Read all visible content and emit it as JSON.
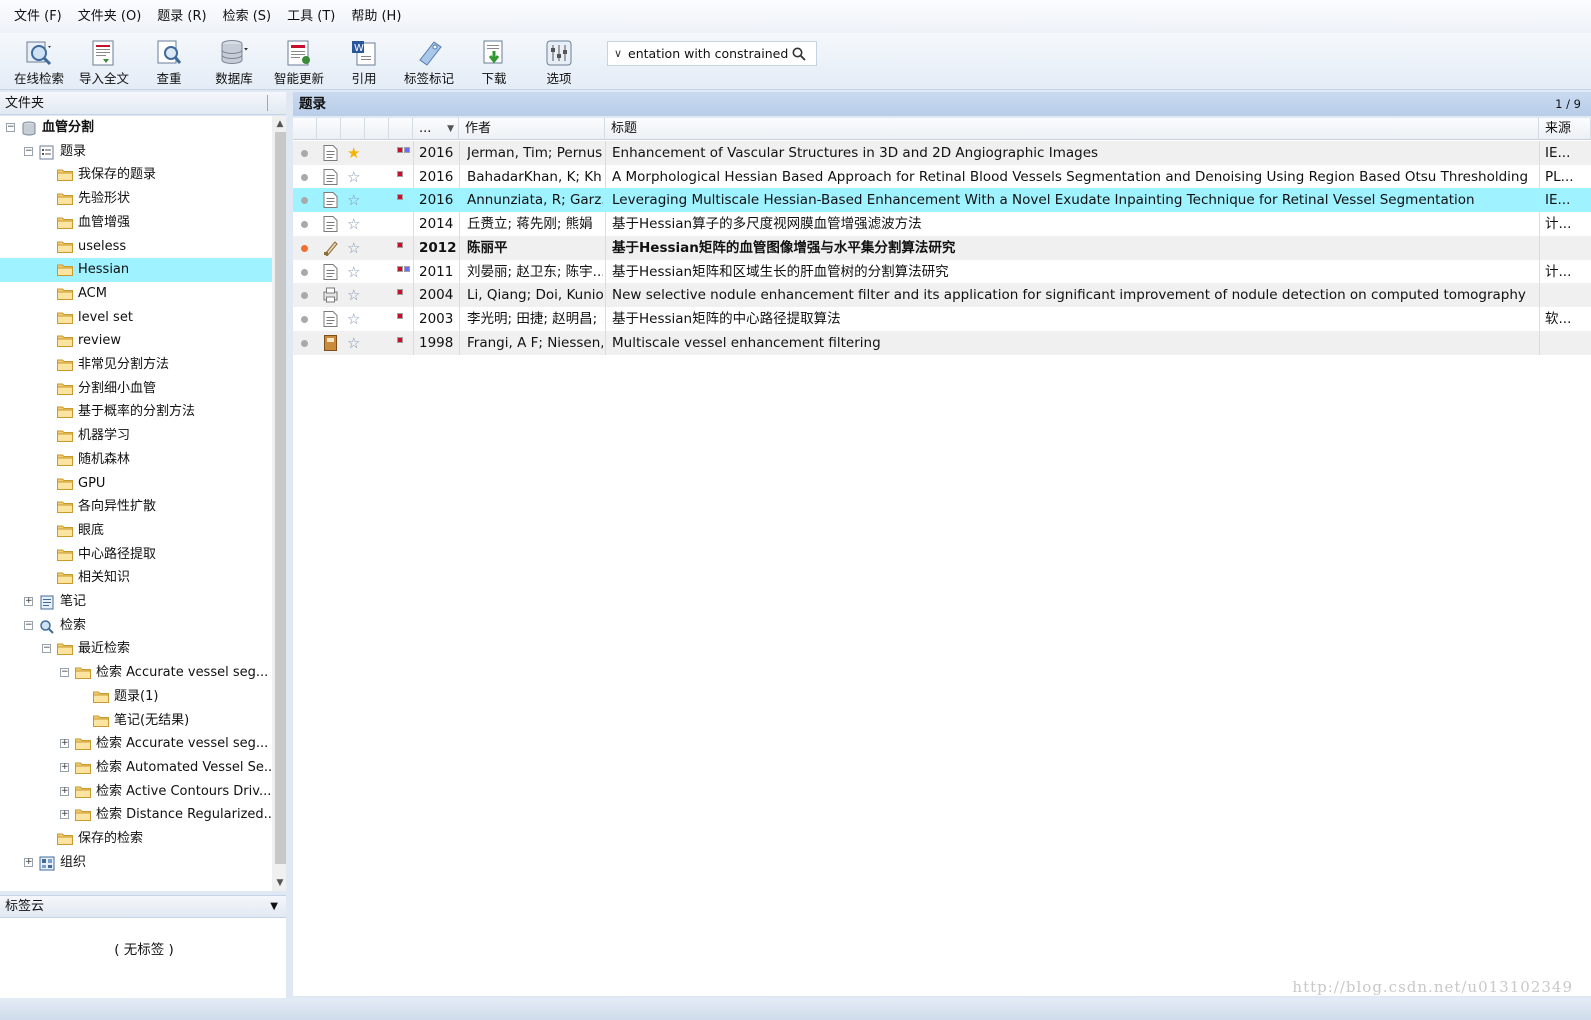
{
  "menu": [
    "文件 (F)",
    "文件夹 (O)",
    "题录 (R)",
    "检索 (S)",
    "工具 (T)",
    "帮助 (H)"
  ],
  "toolbar": {
    "buttons": [
      {
        "label": "在线检索",
        "icon": "online-search-icon"
      },
      {
        "label": "导入全文",
        "icon": "import-fulltext-icon"
      },
      {
        "label": "查重",
        "icon": "duplicate-check-icon"
      },
      {
        "label": "数据库",
        "icon": "database-icon"
      },
      {
        "label": "智能更新",
        "icon": "smart-update-icon"
      },
      {
        "label": "引用",
        "icon": "cite-icon"
      },
      {
        "label": "标签标记",
        "icon": "tag-mark-icon"
      },
      {
        "label": "下载",
        "icon": "download-icon"
      },
      {
        "label": "选项",
        "icon": "options-icon"
      }
    ],
    "search_value": "entation with constrained B"
  },
  "left_panel": {
    "title": "文件夹",
    "tree": [
      {
        "label": "血管分割",
        "level": 0,
        "expander": "-",
        "icon": "database",
        "bold": true
      },
      {
        "label": "题录",
        "level": 1,
        "expander": "-",
        "icon": "list"
      },
      {
        "label": "我保存的题录",
        "level": 2,
        "icon": "folder"
      },
      {
        "label": "先验形状",
        "level": 2,
        "icon": "folder"
      },
      {
        "label": "血管增强",
        "level": 2,
        "icon": "folder"
      },
      {
        "label": "useless",
        "level": 2,
        "icon": "folder"
      },
      {
        "label": "Hessian",
        "level": 2,
        "icon": "folder",
        "selected": true
      },
      {
        "label": "ACM",
        "level": 2,
        "icon": "folder"
      },
      {
        "label": "level set",
        "level": 2,
        "icon": "folder"
      },
      {
        "label": "review",
        "level": 2,
        "icon": "folder"
      },
      {
        "label": "非常见分割方法",
        "level": 2,
        "icon": "folder"
      },
      {
        "label": "分割细小血管",
        "level": 2,
        "icon": "folder"
      },
      {
        "label": "基于概率的分割方法",
        "level": 2,
        "icon": "folder"
      },
      {
        "label": "机器学习",
        "level": 2,
        "icon": "folder"
      },
      {
        "label": "随机森林",
        "level": 2,
        "icon": "folder"
      },
      {
        "label": "GPU",
        "level": 2,
        "icon": "folder"
      },
      {
        "label": "各向异性扩散",
        "level": 2,
        "icon": "folder"
      },
      {
        "label": "眼底",
        "level": 2,
        "icon": "folder"
      },
      {
        "label": "中心路径提取",
        "level": 2,
        "icon": "folder"
      },
      {
        "label": "相关知识",
        "level": 2,
        "icon": "folder"
      },
      {
        "label": "笔记",
        "level": 1,
        "expander": "+",
        "icon": "notes"
      },
      {
        "label": "检索",
        "level": 1,
        "expander": "-",
        "icon": "search"
      },
      {
        "label": "最近检索",
        "level": 2,
        "expander": "-",
        "icon": "folder"
      },
      {
        "label": "检索 Accurate vessel seg...",
        "level": 3,
        "expander": "-",
        "icon": "folder"
      },
      {
        "label": "题录(1)",
        "level": 4,
        "icon": "folder"
      },
      {
        "label": "笔记(无结果)",
        "level": 4,
        "icon": "folder"
      },
      {
        "label": "检索 Accurate vessel seg...",
        "level": 3,
        "expander": "+",
        "icon": "folder"
      },
      {
        "label": "检索 Automated Vessel Se...",
        "level": 3,
        "expander": "+",
        "icon": "folder"
      },
      {
        "label": "检索 Active Contours Driv...",
        "level": 3,
        "expander": "+",
        "icon": "folder"
      },
      {
        "label": "检索 Distance Regularized...",
        "level": 3,
        "expander": "+",
        "icon": "folder"
      },
      {
        "label": "保存的检索",
        "level": 2,
        "icon": "folder"
      },
      {
        "label": "组织",
        "level": 1,
        "expander": "+",
        "icon": "org"
      }
    ],
    "tag_cloud": {
      "title": "标签云",
      "empty_text": "( 无标签 )"
    }
  },
  "right_panel": {
    "title": "题录",
    "page_count": "1 / 9",
    "columns": [
      "...",
      "作者",
      "标题",
      "来源"
    ],
    "rows": [
      {
        "status": "gray",
        "type": "doc",
        "star": "gold",
        "pdf": "two",
        "year": "2016",
        "author": "Jerman, Tim; Pernus,...",
        "title": "Enhancement of Vascular Structures in 3D and 2D Angiographic Images",
        "source": "IE..."
      },
      {
        "status": "gray",
        "type": "doc",
        "star": "empty",
        "pdf": "one",
        "year": "2016",
        "author": "BahadarKhan, K; Kh...",
        "title": "A Morphological Hessian Based Approach for Retinal Blood Vessels Segmentation and Denoising Using Region Based Otsu Thresholding",
        "source": "PL..."
      },
      {
        "status": "gray",
        "type": "doc",
        "star": "empty",
        "pdf": "one",
        "year": "2016",
        "author": "Annunziata, R; Garz...",
        "title": "Leveraging Multiscale Hessian-Based Enhancement With a Novel Exudate Inpainting Technique for Retinal Vessel Segmentation",
        "source": "IE...",
        "selected": true
      },
      {
        "status": "gray",
        "type": "doc",
        "star": "empty",
        "pdf": "none",
        "year": "2014",
        "author": "丘赉立; 蒋先刚; 熊娟",
        "title": "基于Hessian算子的多尺度视网膜血管增强滤波方法",
        "source": "计..."
      },
      {
        "status": "orange",
        "type": "thesis",
        "star": "empty",
        "pdf": "one",
        "year": "2012",
        "author": "陈丽平",
        "title": "基于Hessian矩阵的血管图像增强与水平集分割算法研究",
        "source": "",
        "bold": true
      },
      {
        "status": "gray",
        "type": "doc",
        "star": "empty",
        "pdf": "two",
        "year": "2011",
        "author": "刘晏丽; 赵卫东; 陈宇...",
        "title": "基于Hessian矩阵和区域生长的肝血管树的分割算法研究",
        "source": "计..."
      },
      {
        "status": "gray",
        "type": "print",
        "star": "empty",
        "pdf": "one",
        "year": "2004",
        "author": "Li, Qiang; Doi, Kunio",
        "title": "New selective nodule enhancement filter and its application for significant improvement of nodule detection on computed tomography",
        "source": ""
      },
      {
        "status": "gray",
        "type": "doc",
        "star": "empty",
        "pdf": "one",
        "year": "2003",
        "author": "李光明; 田捷; 赵明昌; ...",
        "title": "基于Hessian矩阵的中心路径提取算法",
        "source": "软..."
      },
      {
        "status": "gray",
        "type": "book",
        "star": "empty",
        "pdf": "one",
        "year": "1998",
        "author": "Frangi, A F; Niessen,...",
        "title": "Multiscale vessel enhancement filtering",
        "source": ""
      }
    ]
  },
  "watermark": "http://blog.csdn.net/u013102349",
  "colors": {
    "selection": "#9ff2ff",
    "header_blue": "#c9daf0",
    "star_gold": "#f4b400",
    "pdf_red": "#c8102e",
    "pdf_blue": "#6c6cff"
  }
}
